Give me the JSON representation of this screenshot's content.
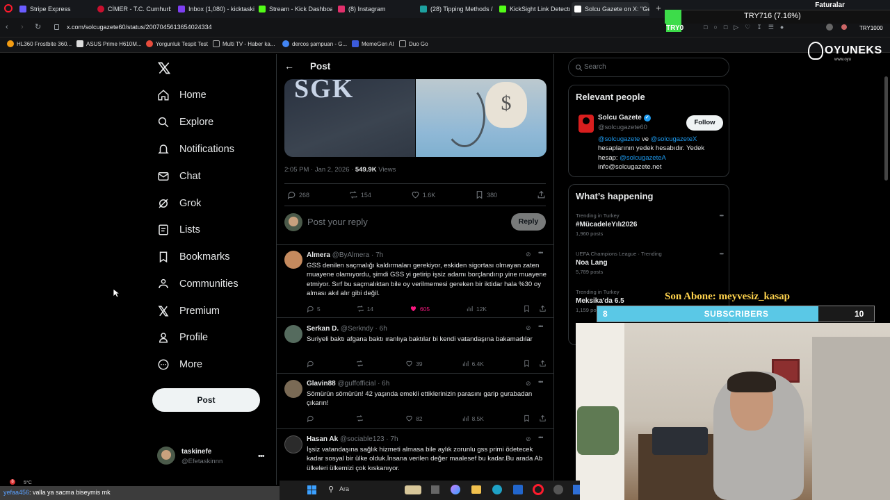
{
  "browser": {
    "tabs": [
      {
        "label": "Stripe Express",
        "color": "#6a5cff"
      },
      {
        "label": "CİMER - T.C. Cumhurbaşk",
        "color": "#c8102e"
      },
      {
        "label": "Inbox (1,080) - kicktaskin",
        "color": "#7e3ff2"
      },
      {
        "label": "Stream - Kick Dashboard",
        "color": "#53fc18"
      },
      {
        "label": "(8) Instagram",
        "color": "#e1306c"
      },
      {
        "label": "(28) Tipping Methods / St",
        "color": "#1da1a0"
      },
      {
        "label": "KickSight Link Detector",
        "color": "#53fc18"
      },
      {
        "label": "Solcu Gazete on X: \"Gene",
        "color": "#ffffff"
      }
    ],
    "url": "x.com/solcugazete60/status/2007045613654024334",
    "bookmarks": [
      "HL360 Frostbite 360...",
      "ASUS Prime H610M...",
      "Yorgunluk Tespit Test",
      "Multi TV - Haber ka...",
      "dercos şampuan - G...",
      "MemeGen AI",
      "Duo Go"
    ]
  },
  "finance_overlay": {
    "title": "Faturalar",
    "amount": "TRY716 (7.16%)",
    "currency": "TRY0",
    "currency_right": "TRY1000"
  },
  "brand_overlay": {
    "name": "OYUNEKS",
    "sub": "www.oyu"
  },
  "nav": {
    "items": [
      "Home",
      "Explore",
      "Notifications",
      "Chat",
      "Grok",
      "Lists",
      "Bookmarks",
      "Communities",
      "Premium",
      "Profile",
      "More"
    ],
    "post_button": "Post",
    "account_name": "taskinefe",
    "account_handle": "@Efetaskinnn"
  },
  "post": {
    "header_title": "Post",
    "image_text": "SGK",
    "timestamp": "2:05 PM · Jan 2, 2026 · ",
    "views_count": "549.9K",
    "views_label": " Views",
    "stats": {
      "replies": "268",
      "reposts": "154",
      "likes": "1.6K",
      "bookmarks": "380"
    },
    "reply_placeholder": "Post your reply",
    "reply_button": "Reply"
  },
  "replies": [
    {
      "name": "Almera",
      "handle": "@ByAlmera · 7h",
      "text": "GSS denilen saçmalığı kaldırmaları gerekiyor, eskiden sigortası olmayan zaten muayene olamıyordu, şimdi GSS yi getirip işsiz adamı borçlandırıp yine muayene etmiyor. Sırf bu saçmalıktan bile oy verilmemesi gereken bir iktidar hala %30 oy alması akıl alır gibi değil.",
      "replies": "5",
      "reposts": "14",
      "likes": "605",
      "views": "12K",
      "liked": true
    },
    {
      "name": "Serkan D.",
      "handle": "@Serkndy · 6h",
      "text": "Suriyeli baktı afgana baktı ıranlıya baktılar bi kendi vatandaşına bakamadılar",
      "replies": "",
      "reposts": "",
      "likes": "39",
      "views": "6.4K",
      "liked": false
    },
    {
      "name": "Glavin88",
      "handle": "@guffofficial · 6h",
      "text": "Sömürün sömürün! 42 yaşında emekli ettiklerinizin parasını garip gurabadan çıkarın!",
      "replies": "",
      "reposts": "",
      "likes": "82",
      "views": "8.5K",
      "liked": false
    },
    {
      "name": "Hasan Ak",
      "handle": "@sociable123 · 7h",
      "text": "İşsiz vatandaşına sağlık hizmeti almasa bile aylık zorunlu gss primi ödetecek kadar sosyal bir ülke olduk.İnsana verilen değer  maalesef bu kadar.Bu arada Ab ülkeleri ülkemizi çok kıskanıyor.",
      "replies": "",
      "reposts": "",
      "likes": "",
      "views": "",
      "liked": false
    }
  ],
  "search": {
    "placeholder": "Search"
  },
  "relevant": {
    "title": "Relevant people",
    "name": "Solcu Gazete",
    "handle": "@solcugazete60",
    "follow": "Follow",
    "bio_link1": "@solcugazete",
    "bio_mid": " ve ",
    "bio_link2": "@solcugazeteX",
    "bio_line2": "hesaplarının yedek hesabıdır. Yedek",
    "bio_line3_prefix": "hesap: ",
    "bio_link3": "@solcugazeteA",
    "bio_email": "info@solcugazete.net"
  },
  "happening": {
    "title": "What’s happening",
    "trends": [
      {
        "context": "Trending in Turkey",
        "name": "#MücadeleYılı2026",
        "posts": "1,960 posts"
      },
      {
        "context": "UEFA Champions League · Trending",
        "name": "Noa Lang",
        "posts": "5,789 posts"
      },
      {
        "context": "Trending in Turkey",
        "name": "Meksika'da 6.5",
        "posts": "1,159 po"
      }
    ]
  },
  "stream_overlay": {
    "last_sub_label": "Son Abone: meyvesiz_kasap",
    "goal_current": "8",
    "goal_label": "SUBSCRIBERS",
    "goal_target": "10",
    "goal_fraction": 0.8,
    "chat_user": "yefaa456",
    "chat_message": ": valla ya sacma biseymis mk",
    "temperature": "5°C",
    "taskbar_search": "Ara"
  },
  "colors": {
    "accent": "#1d9bf0",
    "like": "#f91880",
    "goal_bar": "#5ac8e6",
    "goal_text": "#ffd34d",
    "kick_green": "#53fc18"
  }
}
